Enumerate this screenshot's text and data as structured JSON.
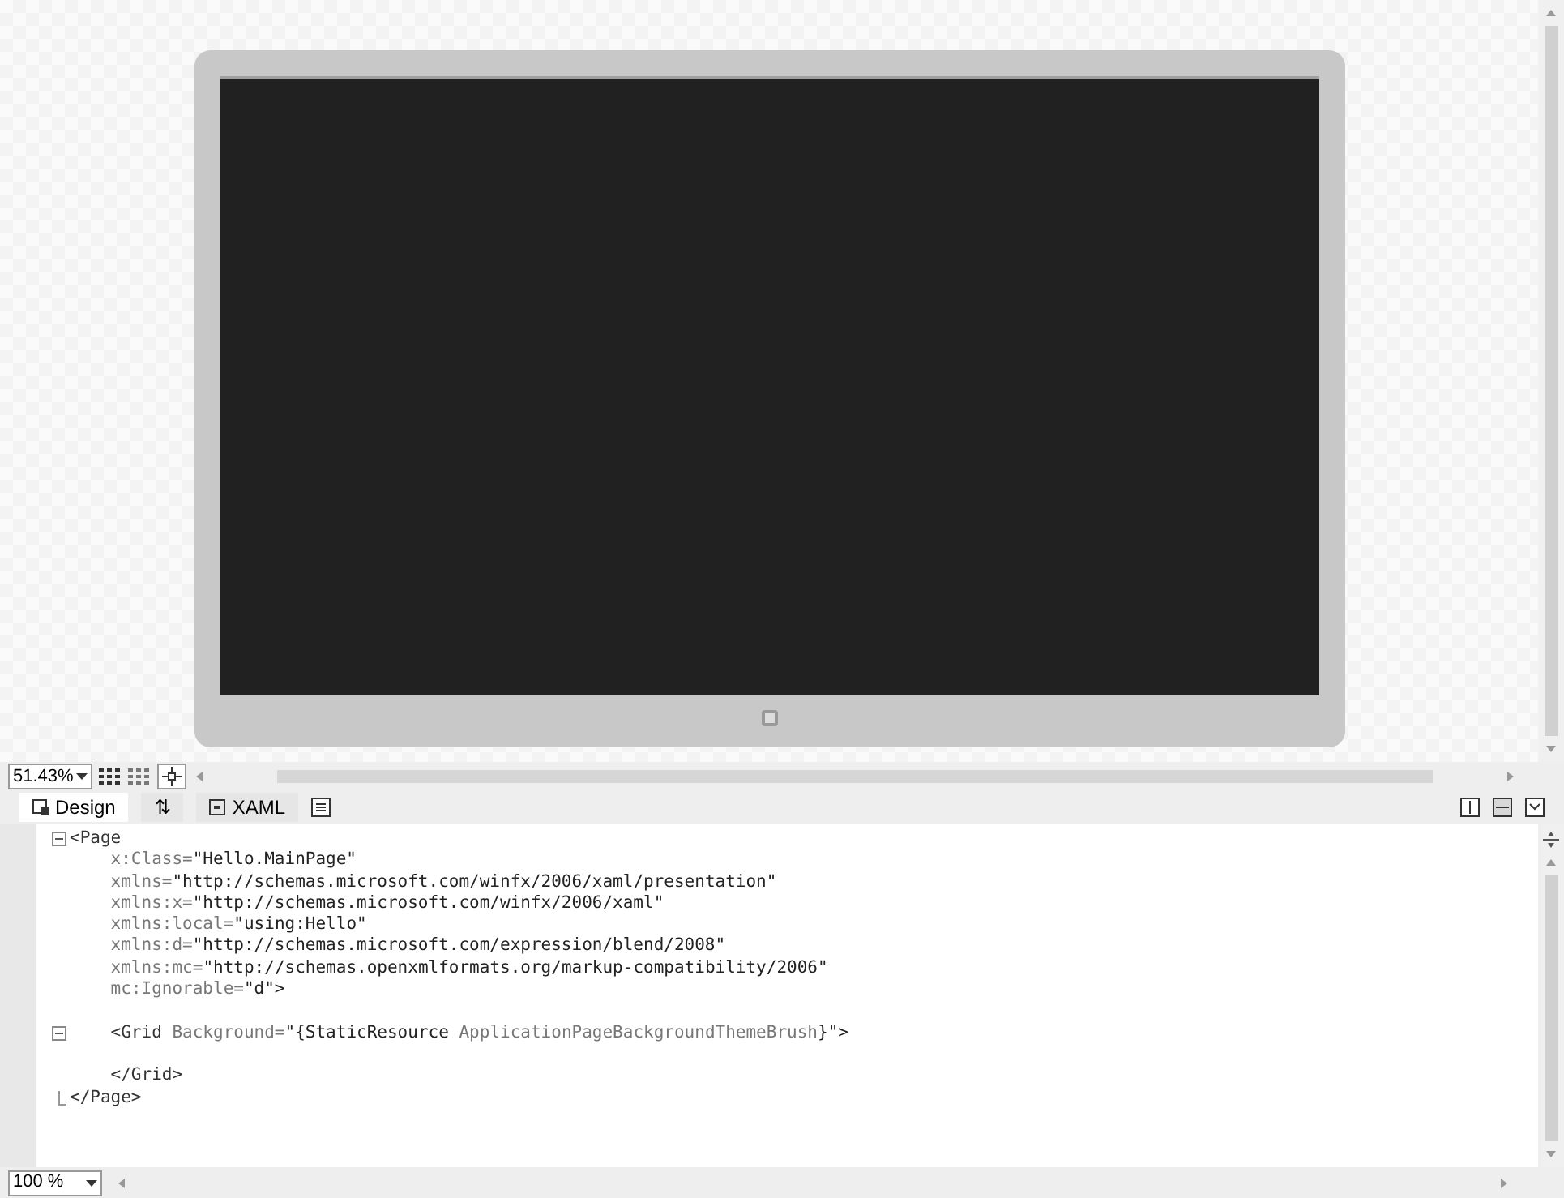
{
  "designer": {
    "zoom": "51.43%"
  },
  "tabs": [
    {
      "label": "Design",
      "selected": true
    },
    {
      "label": "⇅",
      "selected": false
    },
    {
      "label": "XAML",
      "selected": false
    }
  ],
  "split_buttons": [
    {
      "selected": false
    },
    {
      "selected": true
    },
    {
      "selected": false
    }
  ],
  "code_lines": [
    {
      "kind": "fold-start",
      "segments": [
        {
          "kind": "tag",
          "text": "<Page"
        }
      ]
    },
    {
      "kind": "line",
      "segments": [
        {
          "kind": "attr",
          "text": "    x:Class="
        },
        {
          "kind": "value",
          "text": "\"Hello.MainPage\""
        }
      ]
    },
    {
      "kind": "line",
      "segments": [
        {
          "kind": "attr",
          "text": "    xmlns="
        },
        {
          "kind": "value",
          "text": "\"http://schemas.microsoft.com/winfx/2006/xaml/presentation\""
        }
      ]
    },
    {
      "kind": "line",
      "segments": [
        {
          "kind": "attr",
          "text": "    xmlns:x="
        },
        {
          "kind": "value",
          "text": "\"http://schemas.microsoft.com/winfx/2006/xaml\""
        }
      ]
    },
    {
      "kind": "line",
      "segments": [
        {
          "kind": "attr",
          "text": "    xmlns:local="
        },
        {
          "kind": "value",
          "text": "\"using:Hello\""
        }
      ]
    },
    {
      "kind": "line",
      "segments": [
        {
          "kind": "attr",
          "text": "    xmlns:d="
        },
        {
          "kind": "value",
          "text": "\"http://schemas.microsoft.com/expression/blend/2008\""
        }
      ]
    },
    {
      "kind": "line",
      "segments": [
        {
          "kind": "attr",
          "text": "    xmlns:mc="
        },
        {
          "kind": "value",
          "text": "\"http://schemas.openxmlformats.org/markup-compatibility/2006\""
        }
      ]
    },
    {
      "kind": "line",
      "segments": [
        {
          "kind": "attr",
          "text": "    mc:Ignorable="
        },
        {
          "kind": "value",
          "text": "\"d\">"
        }
      ]
    },
    {
      "kind": "blank"
    },
    {
      "kind": "fold-start",
      "segments": [
        {
          "kind": "tag",
          "text": "    <Grid "
        },
        {
          "kind": "attr",
          "text": "Background="
        },
        {
          "kind": "value",
          "text": "\"{StaticResource "
        },
        {
          "kind": "attr",
          "text": "ApplicationPageBackgroundThemeBrush"
        },
        {
          "kind": "value",
          "text": "}\">"
        }
      ]
    },
    {
      "kind": "blank"
    },
    {
      "kind": "line",
      "segments": [
        {
          "kind": "tag",
          "text": "    </Grid>"
        }
      ]
    },
    {
      "kind": "fold-end",
      "segments": [
        {
          "kind": "tag",
          "text": "</Page>"
        }
      ]
    }
  ],
  "editor": {
    "zoom": "100 %"
  }
}
